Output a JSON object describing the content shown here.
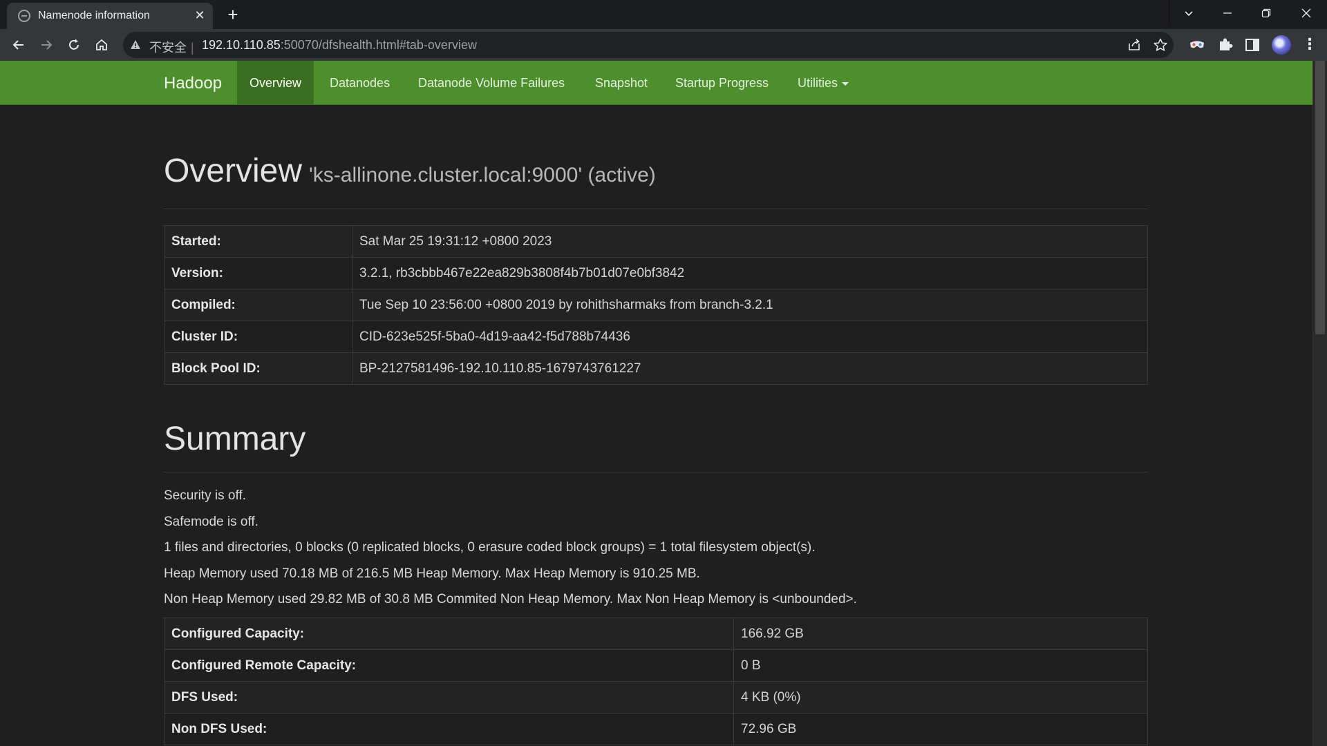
{
  "browser": {
    "tab_title": "Namenode information",
    "insecure_label": "不安全",
    "url_host": "192.10.110.85",
    "url_path": ":50070/dfshealth.html#tab-overview"
  },
  "navbar": {
    "brand": "Hadoop",
    "items": [
      {
        "label": "Overview",
        "active": true
      },
      {
        "label": "Datanodes"
      },
      {
        "label": "Datanode Volume Failures"
      },
      {
        "label": "Snapshot"
      },
      {
        "label": "Startup Progress"
      },
      {
        "label": "Utilities"
      }
    ]
  },
  "overview": {
    "title": "Overview",
    "subtitle": "'ks-allinone.cluster.local:9000' (active)",
    "rows": [
      {
        "key": "Started:",
        "value": "Sat Mar 25 19:31:12 +0800 2023"
      },
      {
        "key": "Version:",
        "value": "3.2.1, rb3cbbb467e22ea829b3808f4b7b01d07e0bf3842"
      },
      {
        "key": "Compiled:",
        "value": "Tue Sep 10 23:56:00 +0800 2019 by rohithsharmaks from branch-3.2.1"
      },
      {
        "key": "Cluster ID:",
        "value": "CID-623e525f-5ba0-4d19-aa42-f5d788b74436"
      },
      {
        "key": "Block Pool ID:",
        "value": "BP-2127581496-192.10.110.85-1679743761227"
      }
    ]
  },
  "summary": {
    "title": "Summary",
    "lines": [
      "Security is off.",
      "Safemode is off.",
      "1 files and directories, 0 blocks (0 replicated blocks, 0 erasure coded block groups) = 1 total filesystem object(s).",
      "Heap Memory used 70.18 MB of 216.5 MB Heap Memory. Max Heap Memory is 910.25 MB.",
      "Non Heap Memory used 29.82 MB of 30.8 MB Commited Non Heap Memory. Max Non Heap Memory is <unbounded>."
    ],
    "rows": [
      {
        "key": "Configured Capacity:",
        "value": "166.92 GB"
      },
      {
        "key": "Configured Remote Capacity:",
        "value": "0 B"
      },
      {
        "key": "DFS Used:",
        "value": "4 KB (0%)"
      },
      {
        "key": "Non DFS Used:",
        "value": "72.96 GB"
      }
    ]
  }
}
